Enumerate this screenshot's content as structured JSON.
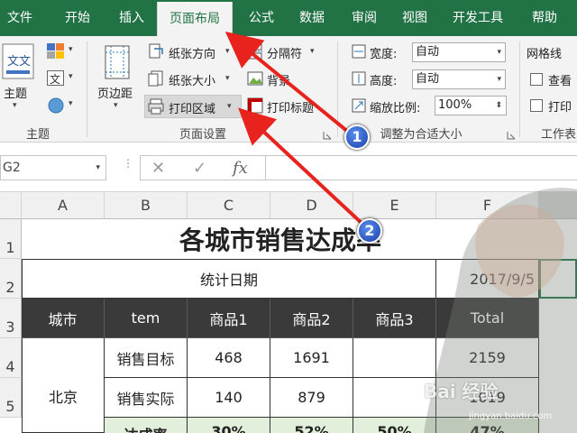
{
  "tabs": [
    "文件",
    "开始",
    "插入",
    "页面布局",
    "公式",
    "数据",
    "审阅",
    "视图",
    "开发工具",
    "帮助"
  ],
  "ribbon": {
    "themes_label": "主题",
    "margins_label": "页边距",
    "orientation_label": "纸张方向",
    "size_label": "纸张大小",
    "print_area_label": "打印区域",
    "breaks_label": "分隔符",
    "background_label": "背景",
    "print_titles_label": "打印标题",
    "width_label": "宽度:",
    "width_value": "自动",
    "height_label": "高度:",
    "height_value": "自动",
    "scale_label": "缩放比例:",
    "scale_value": "100%",
    "gridlines_label": "网格线",
    "view_label": "查看",
    "print_label": "打印",
    "group_themes": "主题",
    "group_page_setup": "页面设置",
    "group_scale_to_fit": "调整为合适大小",
    "group_sheet_options": "工作表"
  },
  "formula_bar": {
    "name_box": "G2",
    "cancel_symbol": "✕",
    "enter_symbol": "✓",
    "fx_symbol": "fx"
  },
  "grid": {
    "columns": [
      "A",
      "B",
      "C",
      "D",
      "E",
      "F"
    ],
    "rows": [
      "1",
      "2",
      "3",
      "4",
      "5"
    ],
    "title": "各城市销售达成率",
    "date_label": "统计日期",
    "date_value": "2017/9/5",
    "headers": [
      "城市",
      "tem",
      "商品1",
      "商品2",
      "商品3",
      "Total"
    ],
    "city": "北京",
    "row_target": {
      "label": "销售目标",
      "c": "468",
      "d": "1691",
      "e": "",
      "f": "2159"
    },
    "row_actual": {
      "label": "销售实际",
      "c": "140",
      "d": "879",
      "e": "",
      "f": "1019"
    },
    "row_rate": {
      "label": "达成率",
      "c": "30%",
      "d": "52%",
      "e": "50%",
      "f": "47%"
    }
  },
  "annotations": {
    "badge1": "1",
    "badge2": "2"
  },
  "watermark": {
    "text": "Bai 经验",
    "url": "jingyan.baidu.com"
  },
  "colors": {
    "excel_green": "#217346",
    "arrow_red": "#e8231e",
    "header_dark": "#3a3a3a"
  }
}
